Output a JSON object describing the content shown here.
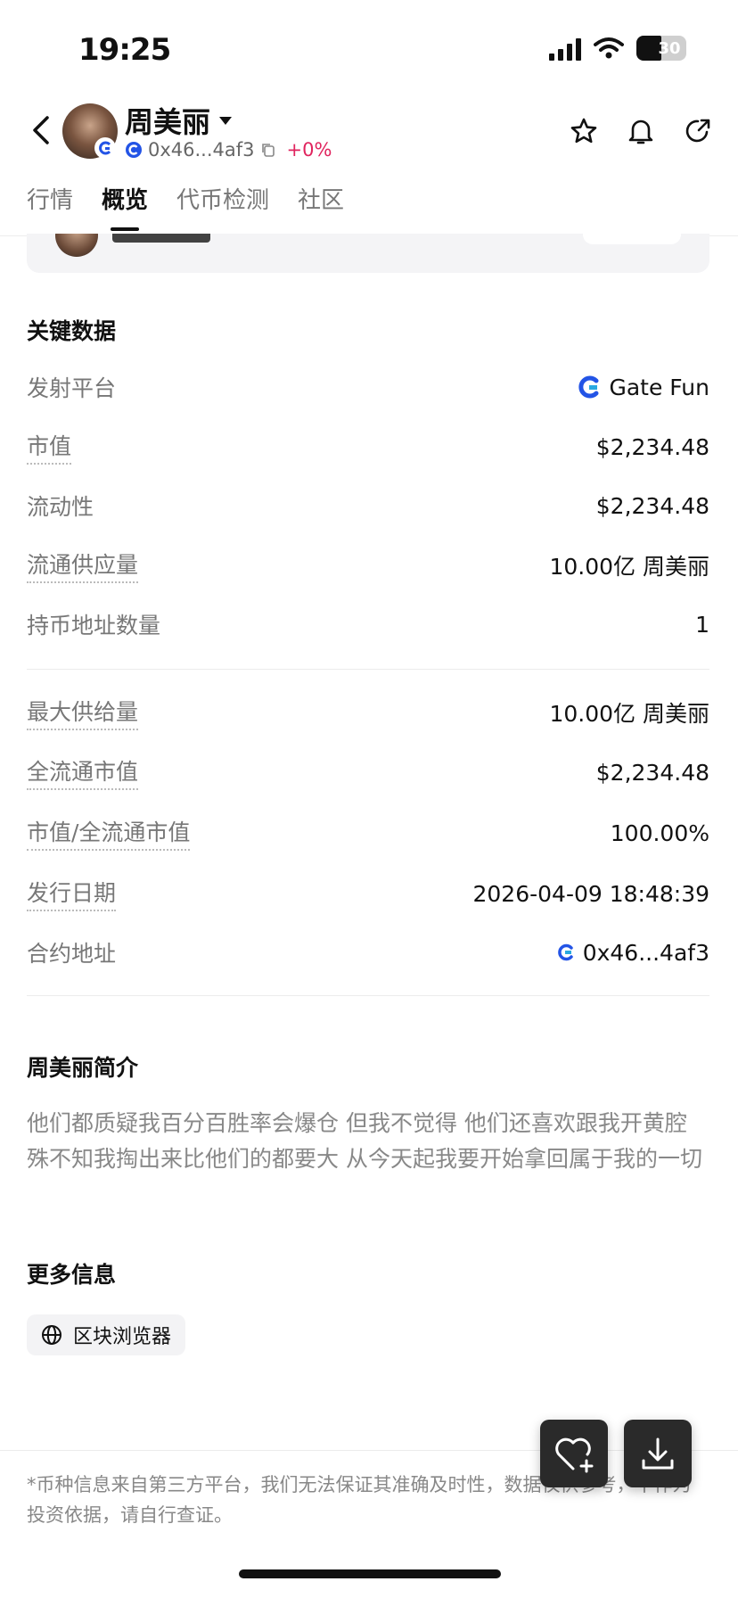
{
  "status_bar": {
    "time": "19:25",
    "battery": "30"
  },
  "header": {
    "token_name": "周美丽",
    "address": "0x46...4af3",
    "change": "+0%"
  },
  "tabs": [
    {
      "label": "行情",
      "active": false
    },
    {
      "label": "概览",
      "active": true
    },
    {
      "label": "代币检测",
      "active": false
    },
    {
      "label": "社区",
      "active": false
    }
  ],
  "key_data": {
    "title": "关键数据",
    "platform_label": "发射平台",
    "platform_value": "Gate Fun",
    "market_cap_label": "市值",
    "market_cap_value": "$2,234.48",
    "liquidity_label": "流动性",
    "liquidity_value": "$2,234.48",
    "circulating_label": "流通供应量",
    "circulating_value": "10.00亿 周美丽",
    "holders_label": "持币地址数量",
    "holders_value": "1",
    "max_supply_label": "最大供给量",
    "max_supply_value": "10.00亿 周美丽",
    "fdv_label": "全流通市值",
    "fdv_value": "$2,234.48",
    "ratio_label": "市值/全流通市值",
    "ratio_value": "100.00%",
    "issue_date_label": "发行日期",
    "issue_date_value": "2026-04-09 18:48:39",
    "contract_label": "合约地址",
    "contract_value": "0x46...4af3"
  },
  "intro": {
    "title": "周美丽简介",
    "text": "他们都质疑我百分百胜率会爆仓 但我不觉得 他们还喜欢跟我开黄腔 殊不知我掏出来比他们的都要大 从今天起我要开始拿回属于我的一切"
  },
  "more_info": {
    "title": "更多信息",
    "explorer_label": "区块浏览器"
  },
  "disclaimer": "*币种信息来自第三方平台，我们无法保证其准确及时性，数据仅供参考，不作为投资依据，请自行查证。",
  "colors": {
    "positive": "#e0245e",
    "gate_blue": "#2354e6"
  }
}
